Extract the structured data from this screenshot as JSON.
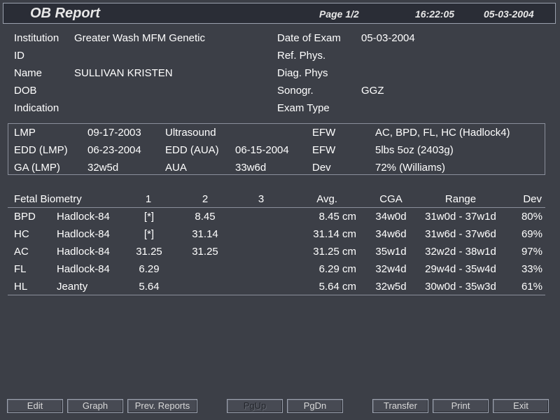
{
  "header": {
    "title": "OB Report",
    "page": "Page 1/2",
    "time": "16:22:05",
    "date": "05-03-2004"
  },
  "patient": {
    "left": [
      {
        "label": "Institution",
        "value": "Greater Wash MFM Genetic"
      },
      {
        "label": "ID",
        "value": ""
      },
      {
        "label": "Name",
        "value": "SULLIVAN KRISTEN"
      },
      {
        "label": "DOB",
        "value": ""
      },
      {
        "label": "Indication",
        "value": ""
      }
    ],
    "right": [
      {
        "label": "Date of Exam",
        "value": "05-03-2004"
      },
      {
        "label": "Ref. Phys.",
        "value": ""
      },
      {
        "label": "Diag. Phys",
        "value": ""
      },
      {
        "label": "Sonogr.",
        "value": "GGZ"
      },
      {
        "label": "Exam Type",
        "value": ""
      }
    ]
  },
  "summary": {
    "rows": [
      [
        "LMP",
        "09-17-2003",
        "Ultrasound",
        "",
        "EFW",
        "AC, BPD, FL, HC (Hadlock4)"
      ],
      [
        "EDD (LMP)",
        "06-23-2004",
        "EDD (AUA)",
        "06-15-2004",
        "EFW",
        "5lbs 5oz (2403g)"
      ],
      [
        "GA (LMP)",
        "32w5d",
        "AUA",
        "33w6d",
        "Dev",
        "72% (Williams)"
      ]
    ]
  },
  "biometry": {
    "headers": [
      "Fetal Biometry",
      "1",
      "2",
      "3",
      "Avg.",
      "CGA",
      "Range",
      "Dev"
    ],
    "rows": [
      {
        "name": "BPD",
        "method": "Hadlock-84",
        "m1": "[*]",
        "m2": "8.45",
        "m3": "",
        "avg": "8.45 cm",
        "cga": "34w0d",
        "range": "31w0d - 37w1d",
        "dev": "80%"
      },
      {
        "name": "HC",
        "method": "Hadlock-84",
        "m1": "[*]",
        "m2": "31.14",
        "m3": "",
        "avg": "31.14 cm",
        "cga": "34w6d",
        "range": "31w6d - 37w6d",
        "dev": "69%"
      },
      {
        "name": "AC",
        "method": "Hadlock-84",
        "m1": "31.25",
        "m2": "31.25",
        "m3": "",
        "avg": "31.25 cm",
        "cga": "35w1d",
        "range": "32w2d - 38w1d",
        "dev": "97%"
      },
      {
        "name": "FL",
        "method": "Hadlock-84",
        "m1": "6.29",
        "m2": "",
        "m3": "",
        "avg": "6.29 cm",
        "cga": "32w4d",
        "range": "29w4d - 35w4d",
        "dev": "33%"
      },
      {
        "name": "HL",
        "method": "Jeanty",
        "m1": "5.64",
        "m2": "",
        "m3": "",
        "avg": "5.64 cm",
        "cga": "32w5d",
        "range": "30w0d - 35w3d",
        "dev": "61%"
      }
    ]
  },
  "buttons": {
    "edit": "Edit",
    "graph": "Graph",
    "prev_reports": "Prev. Reports",
    "pgup": "PgUp",
    "pgdn": "PgDn",
    "transfer": "Transfer",
    "print": "Print",
    "exit": "Exit"
  }
}
